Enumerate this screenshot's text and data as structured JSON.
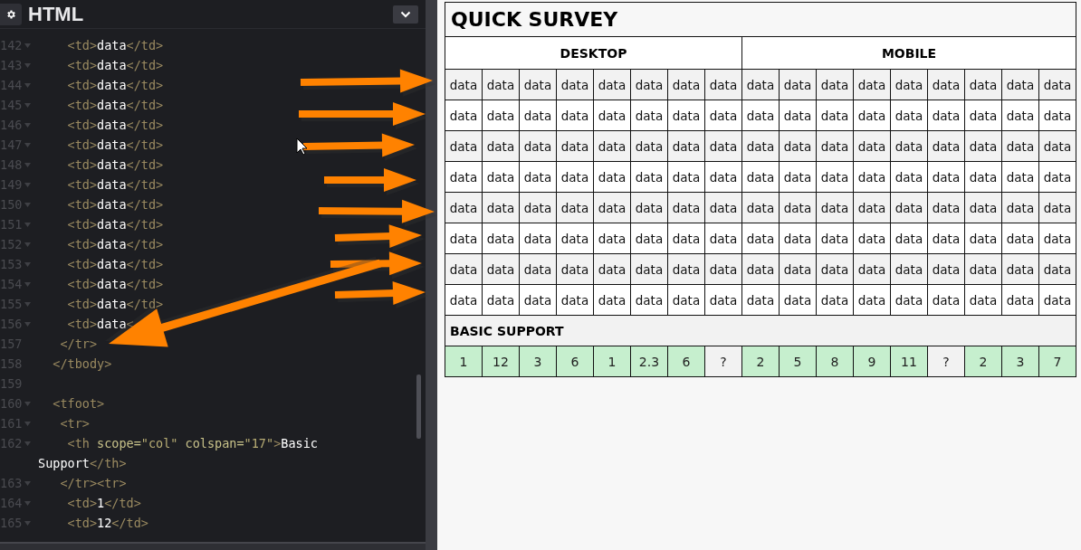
{
  "editor": {
    "title": "HTML",
    "lines": [
      {
        "number": "142",
        "fold": true,
        "tokens": [
          {
            "kind": "tag",
            "text": "    <td>"
          },
          {
            "kind": "text",
            "text": "data"
          },
          {
            "kind": "tag",
            "text": "</td>"
          }
        ]
      },
      {
        "number": "143",
        "fold": true,
        "tokens": [
          {
            "kind": "tag",
            "text": "    <td>"
          },
          {
            "kind": "text",
            "text": "data"
          },
          {
            "kind": "tag",
            "text": "</td>"
          }
        ]
      },
      {
        "number": "144",
        "fold": true,
        "tokens": [
          {
            "kind": "tag",
            "text": "    <td>"
          },
          {
            "kind": "text",
            "text": "data"
          },
          {
            "kind": "tag",
            "text": "</td>"
          }
        ]
      },
      {
        "number": "145",
        "fold": true,
        "tokens": [
          {
            "kind": "tag",
            "text": "    <td>"
          },
          {
            "kind": "text",
            "text": "data"
          },
          {
            "kind": "tag",
            "text": "</td>"
          }
        ]
      },
      {
        "number": "146",
        "fold": true,
        "tokens": [
          {
            "kind": "tag",
            "text": "    <td>"
          },
          {
            "kind": "text",
            "text": "data"
          },
          {
            "kind": "tag",
            "text": "</td>"
          }
        ]
      },
      {
        "number": "147",
        "fold": true,
        "tokens": [
          {
            "kind": "tag",
            "text": "    <td>"
          },
          {
            "kind": "text",
            "text": "data"
          },
          {
            "kind": "tag",
            "text": "</td>"
          }
        ]
      },
      {
        "number": "148",
        "fold": true,
        "tokens": [
          {
            "kind": "tag",
            "text": "    <td>"
          },
          {
            "kind": "text",
            "text": "data"
          },
          {
            "kind": "tag",
            "text": "</td>"
          }
        ]
      },
      {
        "number": "149",
        "fold": true,
        "tokens": [
          {
            "kind": "tag",
            "text": "    <td>"
          },
          {
            "kind": "text",
            "text": "data"
          },
          {
            "kind": "tag",
            "text": "</td>"
          }
        ]
      },
      {
        "number": "150",
        "fold": true,
        "tokens": [
          {
            "kind": "tag",
            "text": "    <td>"
          },
          {
            "kind": "text",
            "text": "data"
          },
          {
            "kind": "tag",
            "text": "</td>"
          }
        ]
      },
      {
        "number": "151",
        "fold": true,
        "tokens": [
          {
            "kind": "tag",
            "text": "    <td>"
          },
          {
            "kind": "text",
            "text": "data"
          },
          {
            "kind": "tag",
            "text": "</td>"
          }
        ]
      },
      {
        "number": "152",
        "fold": true,
        "tokens": [
          {
            "kind": "tag",
            "text": "    <td>"
          },
          {
            "kind": "text",
            "text": "data"
          },
          {
            "kind": "tag",
            "text": "</td>"
          }
        ]
      },
      {
        "number": "153",
        "fold": true,
        "tokens": [
          {
            "kind": "tag",
            "text": "    <td>"
          },
          {
            "kind": "text",
            "text": "data"
          },
          {
            "kind": "tag",
            "text": "</td>"
          }
        ]
      },
      {
        "number": "154",
        "fold": true,
        "tokens": [
          {
            "kind": "tag",
            "text": "    <td>"
          },
          {
            "kind": "text",
            "text": "data"
          },
          {
            "kind": "tag",
            "text": "</td>"
          }
        ]
      },
      {
        "number": "155",
        "fold": true,
        "tokens": [
          {
            "kind": "tag",
            "text": "    <td>"
          },
          {
            "kind": "text",
            "text": "data"
          },
          {
            "kind": "tag",
            "text": "</td>"
          }
        ]
      },
      {
        "number": "156",
        "fold": true,
        "tokens": [
          {
            "kind": "tag",
            "text": "    <td>"
          },
          {
            "kind": "text",
            "text": "data"
          },
          {
            "kind": "tag",
            "text": "<"
          }
        ]
      },
      {
        "number": "157",
        "fold": false,
        "tokens": [
          {
            "kind": "tag",
            "text": "   </tr>"
          }
        ]
      },
      {
        "number": "158",
        "fold": false,
        "tokens": [
          {
            "kind": "tag",
            "text": "  </tbody>"
          }
        ]
      },
      {
        "number": "159",
        "fold": false
      },
      {
        "number": "160",
        "fold": true,
        "tokens": [
          {
            "kind": "tag",
            "text": "  <tfoot>"
          }
        ]
      },
      {
        "number": "161",
        "fold": true,
        "tokens": [
          {
            "kind": "tag",
            "text": "   <tr>"
          }
        ]
      },
      {
        "number": "162",
        "fold": true,
        "tokens": [
          {
            "kind": "tag",
            "text": "    <th"
          },
          {
            "kind": "attr",
            "text": " scope="
          },
          {
            "kind": "string",
            "text": "\"col\""
          },
          {
            "kind": "attr",
            "text": " colspan="
          },
          {
            "kind": "string",
            "text": "\"17\""
          },
          {
            "kind": "tag",
            "text": ">"
          },
          {
            "kind": "text",
            "text": "Basic"
          }
        ]
      },
      {
        "tokens": [
          {
            "kind": "text",
            "text": "Support"
          },
          {
            "kind": "tag",
            "text": "</th>"
          }
        ]
      },
      {
        "number": "163",
        "fold": true,
        "tokens": [
          {
            "kind": "tag",
            "text": "   </tr><tr>"
          }
        ]
      },
      {
        "number": "164",
        "fold": true,
        "tokens": [
          {
            "kind": "tag",
            "text": "    <td>"
          },
          {
            "kind": "text",
            "text": "1"
          },
          {
            "kind": "tag",
            "text": "</td>"
          }
        ]
      },
      {
        "number": "165",
        "fold": true,
        "tokens": [
          {
            "kind": "tag",
            "text": "    <td>"
          },
          {
            "kind": "text",
            "text": "12"
          },
          {
            "kind": "tag",
            "text": "</td>"
          }
        ]
      }
    ]
  },
  "survey": {
    "title": "QUICK SURVEY",
    "groups": [
      {
        "label": "DESKTOP"
      },
      {
        "label": "MOBILE"
      }
    ],
    "rows": [
      [
        "data",
        "data",
        "data",
        "data",
        "data",
        "data",
        "data",
        "data",
        "data",
        "data",
        "data",
        "data",
        "data",
        "data",
        "data",
        "data",
        "data"
      ],
      [
        "data",
        "data",
        "data",
        "data",
        "data",
        "data",
        "data",
        "data",
        "data",
        "data",
        "data",
        "data",
        "data",
        "data",
        "data",
        "data",
        "data"
      ],
      [
        "data",
        "data",
        "data",
        "data",
        "data",
        "data",
        "data",
        "data",
        "data",
        "data",
        "data",
        "data",
        "data",
        "data",
        "data",
        "data",
        "data"
      ],
      [
        "data",
        "data",
        "data",
        "data",
        "data",
        "data",
        "data",
        "data",
        "data",
        "data",
        "data",
        "data",
        "data",
        "data",
        "data",
        "data",
        "data"
      ],
      [
        "data",
        "data",
        "data",
        "data",
        "data",
        "data",
        "data",
        "data",
        "data",
        "data",
        "data",
        "data",
        "data",
        "data",
        "data",
        "data",
        "data"
      ],
      [
        "data",
        "data",
        "data",
        "data",
        "data",
        "data",
        "data",
        "data",
        "data",
        "data",
        "data",
        "data",
        "data",
        "data",
        "data",
        "data",
        "data"
      ],
      [
        "data",
        "data",
        "data",
        "data",
        "data",
        "data",
        "data",
        "data",
        "data",
        "data",
        "data",
        "data",
        "data",
        "data",
        "data",
        "data",
        "data"
      ],
      [
        "data",
        "data",
        "data",
        "data",
        "data",
        "data",
        "data",
        "data",
        "data",
        "data",
        "data",
        "data",
        "data",
        "data",
        "data",
        "data",
        "data"
      ]
    ],
    "footer": {
      "title": "BASIC SUPPORT",
      "cells": [
        {
          "value": "1",
          "supported": true
        },
        {
          "value": "12",
          "supported": true
        },
        {
          "value": "3",
          "supported": true
        },
        {
          "value": "6",
          "supported": true
        },
        {
          "value": "1",
          "supported": true
        },
        {
          "value": "2.3",
          "supported": true
        },
        {
          "value": "6",
          "supported": true
        },
        {
          "value": "?",
          "supported": false
        },
        {
          "value": "2",
          "supported": true
        },
        {
          "value": "5",
          "supported": true
        },
        {
          "value": "8",
          "supported": true
        },
        {
          "value": "9",
          "supported": true
        },
        {
          "value": "11",
          "supported": true
        },
        {
          "value": "?",
          "supported": false
        },
        {
          "value": "2",
          "supported": true
        },
        {
          "value": "3",
          "supported": true
        },
        {
          "value": "7",
          "supported": true
        }
      ]
    }
  }
}
